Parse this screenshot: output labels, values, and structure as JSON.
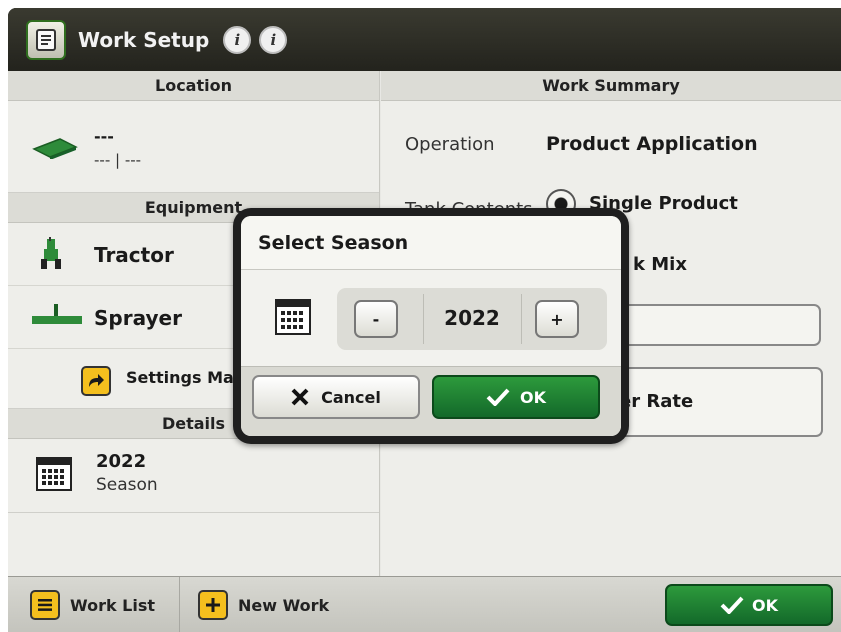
{
  "window": {
    "title": "Work Setup"
  },
  "location": {
    "header": "Location",
    "line1": "---",
    "line2": "--- | ---"
  },
  "equipment": {
    "header": "Equipment",
    "tractor": "Tractor",
    "sprayer": "Sprayer",
    "settings": "Settings Mana"
  },
  "details": {
    "header": "Details",
    "value": "2022",
    "label": "Season"
  },
  "summary": {
    "header": "Work Summary",
    "operation_label": "Operation",
    "operation_value": "Product Application",
    "tank_label": "Tank Contents",
    "tank_option1": "Single Product",
    "tank_option2_partial": "k Mix",
    "rate_partial": "er Rate"
  },
  "footer": {
    "work_list": "Work List",
    "new_work": "New Work",
    "ok": "OK"
  },
  "dialog": {
    "title": "Select Season",
    "minus": "-",
    "value": "2022",
    "plus": "+",
    "cancel": "Cancel",
    "ok": "OK"
  },
  "colors": {
    "accent_green": "#1e7d2f",
    "warning_yellow": "#f4bf1e",
    "titlebar": "#2d2d25"
  }
}
